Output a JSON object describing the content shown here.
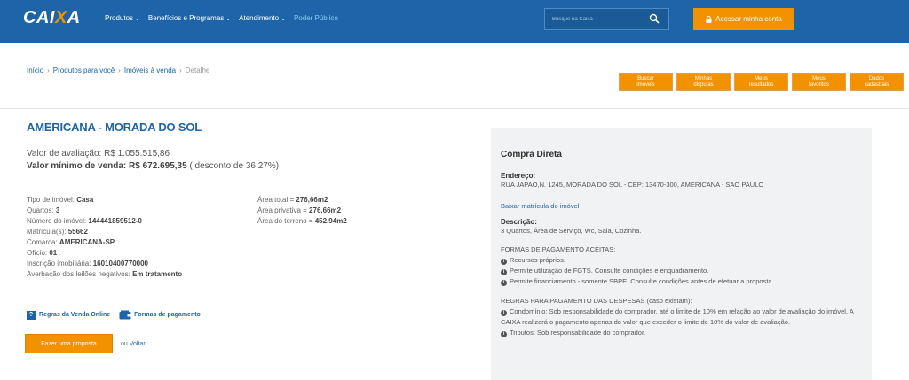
{
  "header": {
    "logo": "CAIXA",
    "nav": [
      {
        "label": "Produtos",
        "caret": true
      },
      {
        "label": "Benefícios e Programas",
        "caret": true
      },
      {
        "label": "Atendimento",
        "caret": true
      },
      {
        "label": "Poder Público",
        "caret": false
      }
    ],
    "search_placeholder": "Busque na Caixa",
    "login_label": "Acessar minha conta"
  },
  "breadcrumb": [
    {
      "label": "Início"
    },
    {
      "label": "Produtos para você"
    },
    {
      "label": "Imóveis à venda"
    },
    {
      "label": "Detalhe"
    }
  ],
  "actions": [
    {
      "line1": "Buscar",
      "line2": "imóveis"
    },
    {
      "line1": "Minhas",
      "line2": "disputas"
    },
    {
      "line1": "Meus",
      "line2": "resultados"
    },
    {
      "line1": "Meus",
      "line2": "favoritos"
    },
    {
      "line1": "Dados",
      "line2": "cadastrais"
    }
  ],
  "property": {
    "title": "AMERICANA - MORADA DO SOL",
    "valuation_label": "Valor de avaliação:",
    "valuation_value": "R$ 1.055.515,86",
    "min_sale_label": "Valor mínimo de venda:",
    "min_sale_value": "R$ 672.695,35",
    "discount": "( desconto de 36,27%)",
    "details_left": [
      {
        "label": "Tipo de imóvel:",
        "value": "Casa"
      },
      {
        "label": "Quartos:",
        "value": "3"
      },
      {
        "label": "Número do imóvel:",
        "value": "144441859512-0"
      },
      {
        "label": "Matrícula(s):",
        "value": "55662"
      },
      {
        "label": "Comarca:",
        "value": "AMERICANA-SP"
      },
      {
        "label": "Ofício:",
        "value": "01"
      },
      {
        "label": "Inscrição imobiliária:",
        "value": "16010400770000"
      },
      {
        "label": "Averbação dos leilões negativos:",
        "value": "Em tratamento"
      }
    ],
    "details_right": [
      {
        "label": "Área total =",
        "value": "276,66m2"
      },
      {
        "label": "Área privativa =",
        "value": "276,66m2"
      },
      {
        "label": "Área do terreno =",
        "value": "452,94m2"
      }
    ],
    "rules_link": "Regras da Venda Online",
    "payment_link": "Formas de pagamento",
    "proposal_button": "Fazer uma proposta",
    "back_prefix": "ou",
    "back_link": "Voltar"
  },
  "panel": {
    "heading": "Compra Direta",
    "address_label": "Endereço:",
    "address": "RUA JAPAO,N. 1245, MORADA DO SOL - CEP: 13470-300, AMERICANA - SAO PAULO",
    "download_link": "Baixar matrícula do imóvel",
    "description_label": "Descrição:",
    "description": "3 Quartos, Área de Serviço, Wc, Sala, Cozinha. .",
    "payment_heading": "FORMAS DE PAGAMENTO ACEITAS:",
    "payment_items": [
      "Recursos próprios.",
      "Permite utilização de FGTS. Consulte condições e enquadramento.",
      "Permite financiamento - somente SBPE. Consulte condições antes de efetuar a proposta."
    ],
    "expenses_heading": "REGRAS PARA PAGAMENTO DAS DESPESAS (caso existam):",
    "expenses_items": [
      "Condomínio: Sob responsabilidade do comprador, até o limite de 10% em relação ao valor de avaliação do imóvel. A CAIXA realizará o pagamento apenas do valor que exceder o limite de 10% do valor de avaliação.",
      "Tributos: Sob responsabilidade do comprador."
    ]
  }
}
